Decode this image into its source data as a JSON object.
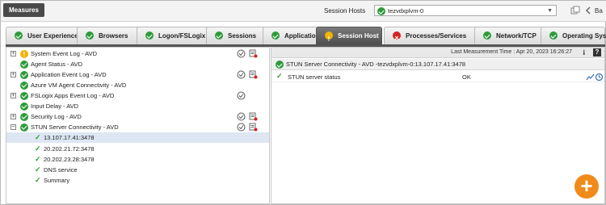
{
  "topbar": {
    "measures_label": "Measures",
    "session_hosts_label": "Session Hosts",
    "session_host_value": "tezvdxplvm-0",
    "back_label": "Ba"
  },
  "tabs": [
    {
      "label": "User Experience",
      "status": "ok"
    },
    {
      "label": "Browsers",
      "status": "ok"
    },
    {
      "label": "Logon/FSLogix",
      "status": "ok"
    },
    {
      "label": "Sessions",
      "status": "ok"
    },
    {
      "label": "Applications",
      "status": "ok"
    },
    {
      "label": "Session Host",
      "status": "warn",
      "active": true
    },
    {
      "label": "Processes/Services",
      "status": "error"
    },
    {
      "label": "Network/TCP",
      "status": "ok"
    },
    {
      "label": "Operating System",
      "status": "ok"
    }
  ],
  "tree": [
    {
      "label": "System Event Log - AVD",
      "status": "warn",
      "expander": "+"
    },
    {
      "label": "Agent Status - AVD",
      "status": "ok"
    },
    {
      "label": "Application Event Log - AVD",
      "status": "ok",
      "expander": "+"
    },
    {
      "label": "Azure VM Agent Connectivity - AVD",
      "status": "ok"
    },
    {
      "label": "FSLogix Apps Event Log - AVD",
      "status": "ok",
      "expander": "+"
    },
    {
      "label": "Input Delay - AVD",
      "status": "ok"
    },
    {
      "label": "Security Log - AVD",
      "status": "ok",
      "expander": "+"
    },
    {
      "label": "STUN Server Connectivity - AVD",
      "status": "ok",
      "expander": "−"
    }
  ],
  "tree_children": [
    {
      "label": "13.107.17.41:3478",
      "selected": true
    },
    {
      "label": "20.202.21.72:3478"
    },
    {
      "label": "20.202.23.28:3478"
    },
    {
      "label": "DNS service"
    },
    {
      "label": "Summary"
    }
  ],
  "detail": {
    "measurement_time": "Last Measurement Time : Apr 20, 2023 16:26:27",
    "info_glyph": "i",
    "help_glyph": "?",
    "title": "STUN Server Connectivity - AVD -tezvdxplvm-0:13.107.17.41:3478",
    "measures": [
      {
        "name": "STUN server status",
        "value": "OK"
      }
    ]
  },
  "fab_symbol": "+",
  "colors": {
    "ok": "#2e9b3a",
    "warn": "#f0b400",
    "error": "#d32020",
    "accent": "#f08a1a",
    "active_tab": "#555555"
  }
}
